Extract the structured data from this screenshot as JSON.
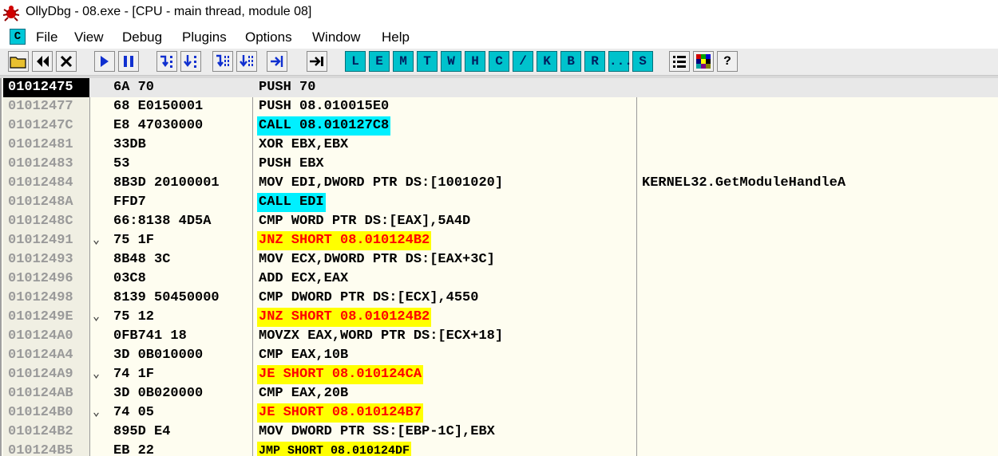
{
  "window": {
    "title": "OllyDbg - 08.exe - [CPU - main thread, module 08]"
  },
  "menu": {
    "icon_label": "C",
    "items": [
      "File",
      "View",
      "Debug",
      "Plugins",
      "Options",
      "Window",
      "Help"
    ]
  },
  "toolbar": {
    "icons": [
      "open-icon",
      "restart-icon",
      "close-icon",
      "run-icon",
      "pause-icon",
      "step-into-icon",
      "step-over-icon",
      "trace-into-icon",
      "trace-over-icon",
      "execute-till-return-icon",
      "go-to-icon"
    ],
    "letter_buttons": [
      "L",
      "E",
      "M",
      "T",
      "W",
      "H",
      "C",
      "/",
      "K",
      "B",
      "R",
      "...",
      "S"
    ],
    "right_icons": [
      "list-icon",
      "colors-icon",
      "help-icon"
    ],
    "help_label": "?"
  },
  "colors": {
    "call_highlight": "#00f0ff",
    "jump_highlight": "#ffff00",
    "jump_text": "#ff0000",
    "address_text": "#9a9a9a",
    "pane_background": "#fefdf0"
  },
  "disassembly": {
    "rows": [
      {
        "address": "01012475",
        "jump": "",
        "hex": "6A 70",
        "asm": "PUSH 70",
        "comment": "",
        "kind": "normal",
        "selected": true
      },
      {
        "address": "01012477",
        "jump": "",
        "hex": "68 E0150001",
        "asm": "PUSH 08.010015E0",
        "comment": "",
        "kind": "normal"
      },
      {
        "address": "0101247C",
        "jump": "",
        "hex": "E8 47030000",
        "asm": "CALL 08.010127C8",
        "comment": "",
        "kind": "call"
      },
      {
        "address": "01012481",
        "jump": "",
        "hex": "33DB",
        "asm": "XOR EBX,EBX",
        "comment": "",
        "kind": "normal"
      },
      {
        "address": "01012483",
        "jump": "",
        "hex": "53",
        "asm": "PUSH EBX",
        "comment": "",
        "kind": "normal"
      },
      {
        "address": "01012484",
        "jump": "",
        "hex": "8B3D 20100001",
        "asm": "MOV EDI,DWORD PTR DS:[1001020]",
        "comment": "KERNEL32.GetModuleHandleA",
        "kind": "normal"
      },
      {
        "address": "0101248A",
        "jump": "",
        "hex": "FFD7",
        "asm": "CALL EDI",
        "comment": "",
        "kind": "call"
      },
      {
        "address": "0101248C",
        "jump": "",
        "hex": "66:8138 4D5A",
        "asm": "CMP WORD PTR DS:[EAX],5A4D",
        "comment": "",
        "kind": "normal"
      },
      {
        "address": "01012491",
        "jump": "⌄",
        "hex": "75 1F",
        "asm": "JNZ SHORT 08.010124B2",
        "comment": "",
        "kind": "jcc"
      },
      {
        "address": "01012493",
        "jump": "",
        "hex": "8B48 3C",
        "asm": "MOV ECX,DWORD PTR DS:[EAX+3C]",
        "comment": "",
        "kind": "normal"
      },
      {
        "address": "01012496",
        "jump": "",
        "hex": "03C8",
        "asm": "ADD ECX,EAX",
        "comment": "",
        "kind": "normal"
      },
      {
        "address": "01012498",
        "jump": "",
        "hex": "8139 50450000",
        "asm": "CMP DWORD PTR DS:[ECX],4550",
        "comment": "",
        "kind": "normal"
      },
      {
        "address": "0101249E",
        "jump": "⌄",
        "hex": "75 12",
        "asm": "JNZ SHORT 08.010124B2",
        "comment": "",
        "kind": "jcc"
      },
      {
        "address": "010124A0",
        "jump": "",
        "hex": "0FB741 18",
        "asm": "MOVZX EAX,WORD PTR DS:[ECX+18]",
        "comment": "",
        "kind": "normal"
      },
      {
        "address": "010124A4",
        "jump": "",
        "hex": "3D 0B010000",
        "asm": "CMP EAX,10B",
        "comment": "",
        "kind": "normal"
      },
      {
        "address": "010124A9",
        "jump": "⌄",
        "hex": "74 1F",
        "asm": "JE SHORT 08.010124CA",
        "comment": "",
        "kind": "jcc"
      },
      {
        "address": "010124AB",
        "jump": "",
        "hex": "3D 0B020000",
        "asm": "CMP EAX,20B",
        "comment": "",
        "kind": "normal"
      },
      {
        "address": "010124B0",
        "jump": "⌄",
        "hex": "74 05",
        "asm": "JE SHORT 08.010124B7",
        "comment": "",
        "kind": "jcc"
      },
      {
        "address": "010124B2",
        "jump": "",
        "hex": "895D E4",
        "asm": "MOV DWORD PTR SS:[EBP-1C],EBX",
        "comment": "",
        "kind": "normal"
      },
      {
        "address": "010124B5",
        "jump": "",
        "hex": "EB 22",
        "asm": "JMP SHORT 08.010124DF",
        "comment": "",
        "kind": "jmp"
      }
    ]
  }
}
